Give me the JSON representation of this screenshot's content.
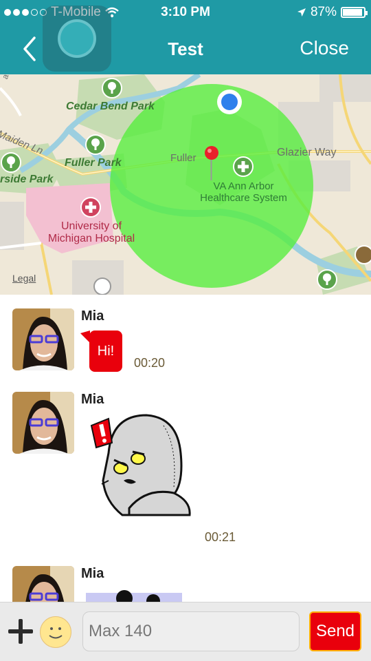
{
  "status_bar": {
    "carrier": "T-Mobile",
    "time": "3:10 PM",
    "battery": "87%",
    "battery_level": 0.87
  },
  "nav": {
    "title": "Test",
    "close_label": "Close",
    "back_icon": "chevron-left-icon"
  },
  "map": {
    "labels": {
      "cedar_bend_park": "Cedar Bend Park",
      "maiden_ln": "Maiden Ln",
      "fuller_park": "Fuller Park",
      "fuller": "Fuller",
      "glazier_way": "Glazier Way",
      "side_park": "rside Park",
      "university_hospital": "University of\nMichigan Hospital",
      "va_ann_arbor": "VA Ann Arbor\nHealthcare System",
      "edge_road": "ave"
    },
    "legal": "Legal",
    "geofence_color": "#55ee3c"
  },
  "messages": [
    {
      "sender": "Mia",
      "type": "text",
      "text": "Hi!",
      "time": "00:20"
    },
    {
      "sender": "Mia",
      "type": "sticker",
      "sticker": "angry-moon-sticker",
      "time": "00:21"
    },
    {
      "sender": "Mia",
      "type": "sticker",
      "sticker": "sticker-partial"
    }
  ],
  "input": {
    "placeholder": "Max 140",
    "send_label": "Send"
  },
  "colors": {
    "header": "#1f9aa5",
    "bubble": "#e9000c",
    "send": "#e9000c"
  }
}
